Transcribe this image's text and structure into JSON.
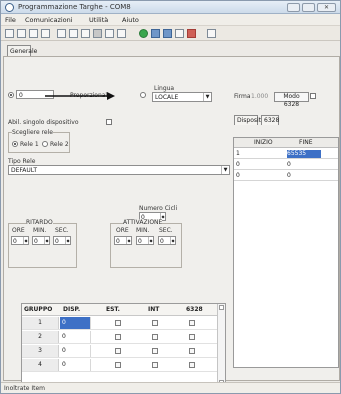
{
  "app": {
    "title": "Programmazione Targhe - COM8"
  },
  "menu": [
    "File",
    "Comunicazioni",
    "Utilità",
    "Aiuto"
  ],
  "tabs": {
    "general": "Generale"
  },
  "top_controls": {
    "id_value": "0",
    "radio_label": "Proporzionale",
    "language_label": "Lingua",
    "language_value": "LOCALE",
    "fw_label": "Firma",
    "fw_value": "1.000",
    "button_label": "Modo 6328"
  },
  "device_panel": {
    "label": "Abil. singolo dispositivo",
    "scelta_label": "Scegliere rele",
    "rele1": "Rele 1",
    "rele2": "Rele 2"
  },
  "tipo_rele": {
    "label": "Tipo Rele",
    "value": "DEFAULT"
  },
  "numero_cicli": {
    "label": "Numero Cicli",
    "value": "0"
  },
  "groups": {
    "ritardo": {
      "label": "RITARDO",
      "headers": [
        "ORE",
        "MIN.",
        "SEC."
      ],
      "values": [
        "0",
        "0",
        "0"
      ]
    },
    "attivazione": {
      "label": "ATTIVAZIONE",
      "headers": [
        "ORE",
        "MIN.",
        "SEC."
      ],
      "values": [
        "0",
        "0",
        "0"
      ]
    }
  },
  "right_tabs": {
    "dispositivo": "Dispositivo",
    "tab2": "6328"
  },
  "right_table": {
    "headers": [
      "INIZIO",
      "FINE"
    ],
    "rows": [
      [
        "1",
        "65535"
      ],
      [
        "0",
        "0"
      ],
      [
        "0",
        "0"
      ]
    ]
  },
  "grid": {
    "headers": [
      "GRUPPO",
      "DISP.",
      "EST.",
      "INT",
      "6328"
    ],
    "rows": [
      {
        "group": "1",
        "disp": "0"
      },
      {
        "group": "2",
        "disp": "0"
      },
      {
        "group": "3",
        "disp": "0"
      },
      {
        "group": "4",
        "disp": "0"
      }
    ]
  },
  "status": {
    "text": "Inoltrate Item"
  }
}
